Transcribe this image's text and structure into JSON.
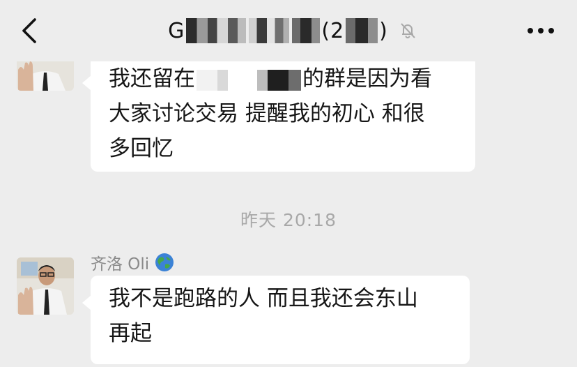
{
  "header": {
    "title_prefix": "G",
    "title_count_prefix": "(2",
    "title_count_suffix": ")",
    "back_icon": "chevron-left-icon",
    "mute_icon": "bell-slash-icon",
    "more_icon": "more-dots-icon"
  },
  "messages": [
    {
      "lines": [
        "我还留在",
        "的群是因为看",
        "大家讨论交易 提醒我的初心 和很",
        "多回忆"
      ]
    },
    {
      "sender": "齐洛 Oli",
      "sender_emoji": "globe-icon",
      "lines": [
        "我不是跑路的人 而且我还会东山",
        "再起"
      ]
    }
  ],
  "timestamp": "昨天 20:18",
  "colors": {
    "background": "#ededed",
    "bubble": "#ffffff",
    "text": "#161616",
    "meta": "#a8a8a8"
  }
}
